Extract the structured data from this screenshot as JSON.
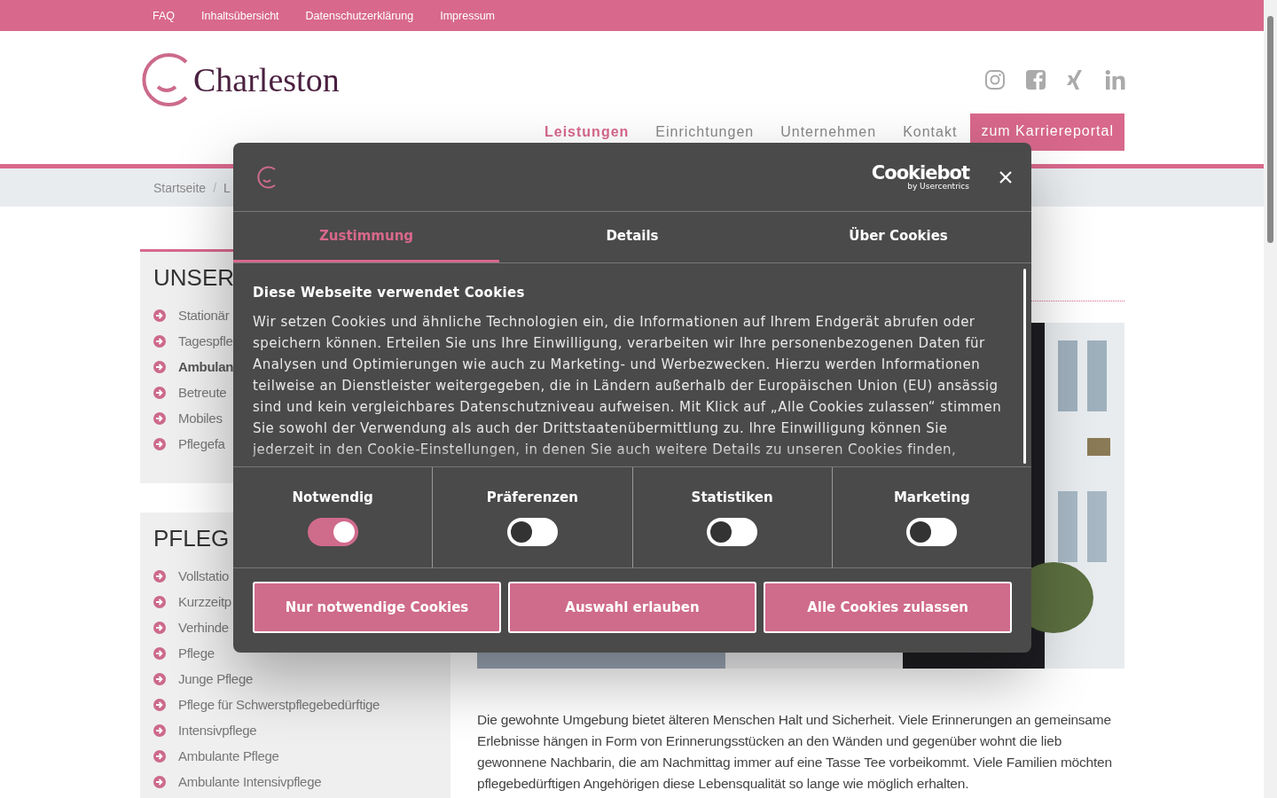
{
  "top_bar": {
    "links": [
      "FAQ",
      "Inhaltsübersicht",
      "Datenschutzerklärung",
      "Impressum"
    ]
  },
  "header": {
    "logo_text": "Charleston",
    "nav": [
      {
        "label": "Leistungen",
        "selected": true
      },
      {
        "label": "Einrichtungen",
        "selected": false
      },
      {
        "label": "Unternehmen",
        "selected": false
      },
      {
        "label": "Kontakt",
        "selected": false
      }
    ],
    "career_button": "zum Karriereportal"
  },
  "breadcrumb": [
    "Startseite",
    "L"
  ],
  "breadcrumb_separator": "/",
  "sidebar": [
    {
      "heading": "UNSER",
      "items": [
        {
          "label": "Stationär",
          "selected": false
        },
        {
          "label": "Tagespfle",
          "selected": false
        },
        {
          "label": "Ambulan",
          "selected": true
        },
        {
          "label": "Betreute",
          "selected": false
        },
        {
          "label": "Mobiles",
          "selected": false
        },
        {
          "label": "Pflegefa",
          "selected": false
        }
      ]
    },
    {
      "heading": "PFLEG",
      "items": [
        {
          "label": "Vollstatio",
          "selected": false
        },
        {
          "label": "Kurzzeitp",
          "selected": false
        },
        {
          "label": "Verhinde",
          "selected": false
        },
        {
          "label": "Pflege",
          "selected": false
        },
        {
          "label": "Junge Pflege",
          "selected": false
        },
        {
          "label": "Pflege für Schwerstpflegebedürftige",
          "selected": false
        },
        {
          "label": "Intensivpflege",
          "selected": false
        },
        {
          "label": "Ambulante Pflege",
          "selected": false
        },
        {
          "label": "Ambulante Intensivpflege",
          "selected": false
        }
      ]
    }
  ],
  "main": {
    "paragraph": "Die gewohnte Umgebung bietet älteren Menschen Halt und Sicherheit. Viele Erinnerungen an gemeinsame Erlebnisse hängen in Form von Erinnerungsstücken an den Wänden und gegenüber wohnt die lieb gewonnene Nachbarin, die am Nachmittag immer auf eine Tasse Tee vorbeikommt. Viele Familien möchten pflegebedürftigen Angehörigen diese Lebensqualität so lange wie möglich erhalten."
  },
  "cookie_dialog": {
    "brand": "Cookiebot",
    "brand_sub": "by Usercentrics",
    "tabs": [
      {
        "label": "Zustimmung",
        "selected": true
      },
      {
        "label": "Details",
        "selected": false
      },
      {
        "label": "Über Cookies",
        "selected": false
      }
    ],
    "title": "Diese Webseite verwendet Cookies",
    "text": "Wir setzen Cookies und ähnliche Technologien ein, die Informationen auf Ihrem Endgerät abrufen oder speichern können. Erteilen Sie uns Ihre Einwilligung, verarbeiten wir Ihre personenbezogenen Daten für Analysen und Optimierungen wie auch zu Marketing- und Werbezwecken. Hierzu werden Informationen teilweise an Dienstleister weitergegeben, die in Ländern außerhalb der Europäischen Union (EU) ansässig sind und kein vergleichbares Datenschutzniveau aufweisen. Mit Klick auf „Alle Cookies zulassen“ stimmen Sie sowohl der Verwendung als auch der Drittstaatenübermittlung zu. Ihre Einwilligung können Sie jederzeit in den Cookie-Einstellungen, in denen Sie auch weitere Details zu unseren Cookies finden,",
    "categories": [
      {
        "label": "Notwendig",
        "checked": true
      },
      {
        "label": "Präferenzen",
        "checked": false
      },
      {
        "label": "Statistiken",
        "checked": false
      },
      {
        "label": "Marketing",
        "checked": false
      }
    ],
    "buttons": [
      "Nur notwendige Cookies",
      "Auswahl erlauben",
      "Alle Cookies zulassen"
    ]
  }
}
